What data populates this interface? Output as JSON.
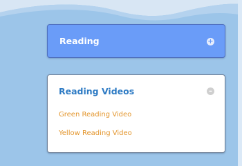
{
  "panels": {
    "reading": {
      "title": "Reading",
      "icon": "plus-circle-icon",
      "icon_glyph": "+"
    },
    "reading_videos": {
      "title": "Reading Videos",
      "icon": "minus-circle-icon",
      "icon_glyph": "–",
      "links": [
        {
          "label": "Green Reading Video"
        },
        {
          "label": "Yellow Reading Video"
        }
      ]
    }
  },
  "colors": {
    "background": "#9cc5e9",
    "reading_panel": "#6a9cf8",
    "videos_title": "#2e7bc4",
    "link": "#e3952c"
  }
}
